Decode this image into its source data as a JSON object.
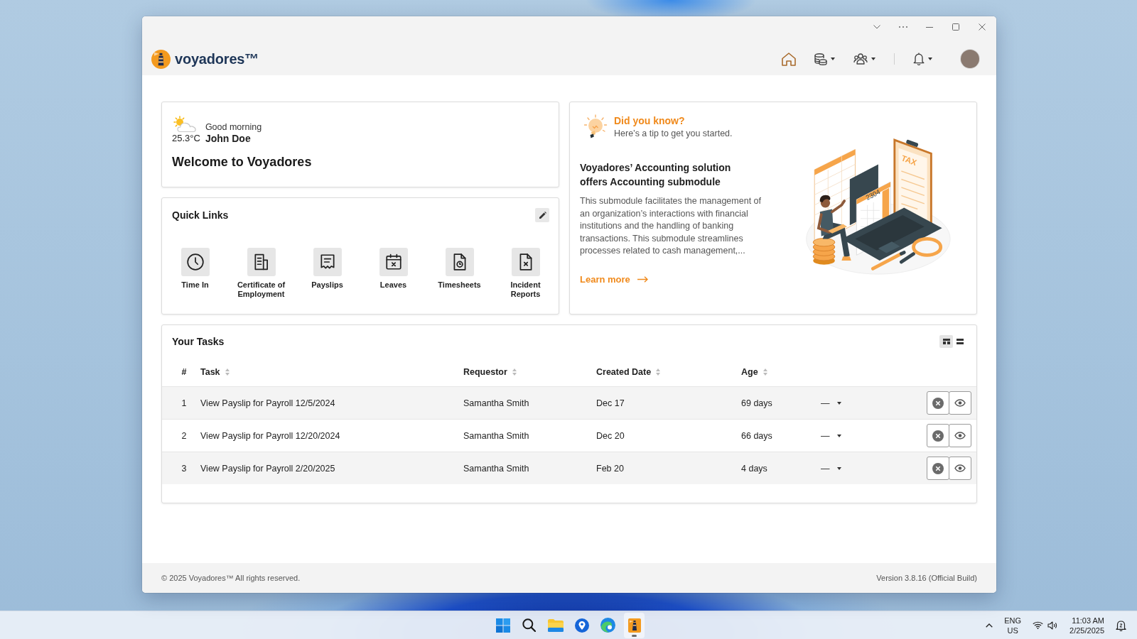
{
  "header": {
    "logo": "voyadores™"
  },
  "welcome": {
    "greeting": "Good morning",
    "temperature": "25.3°C",
    "user_name": "John Doe",
    "title": "Welcome to Voyadores"
  },
  "quick_links": {
    "title": "Quick Links",
    "items": [
      {
        "kind": "clock",
        "label": "Time In"
      },
      {
        "kind": "certificate",
        "label": "Certificate of Employment"
      },
      {
        "kind": "receipt",
        "label": "Payslips"
      },
      {
        "kind": "calendar-x",
        "label": "Leaves"
      },
      {
        "kind": "file-clock",
        "label": "Timesheets"
      },
      {
        "kind": "file-x",
        "label": "Incident Reports"
      }
    ]
  },
  "tip": {
    "title": "Did you know?",
    "subtitle": "Here’s a tip to get you started.",
    "heading": "Voyadores’ Accounting solution offers Accounting submodule",
    "body": "This submodule facilitates the management of an organization’s interactions with financial institutions and the handling of banking transactions. This submodule streamlines processes related to cash management,...",
    "link": "Learn more",
    "illustration": {
      "clipboard_label": "TAX",
      "calculator_display": "2304"
    }
  },
  "tasks": {
    "title": "Your Tasks",
    "view_toggle": [
      {
        "kind": "board",
        "selected": true
      },
      {
        "kind": "list",
        "selected": false
      }
    ],
    "columns": [
      {
        "label": "#",
        "sortable": false
      },
      {
        "label": "Task",
        "sortable": true
      },
      {
        "label": "Requestor",
        "sortable": true
      },
      {
        "label": "Created Date",
        "sortable": true
      },
      {
        "label": "Age",
        "sortable": true
      }
    ],
    "rows": [
      {
        "index": "1",
        "task": "View Payslip for Payroll 12/5/2024",
        "requestor": "Samantha Smith",
        "created_date": "Dec 17",
        "age": "69 days",
        "column_6": "—"
      },
      {
        "index": "2",
        "task": "View Payslip for Payroll 12/20/2024",
        "requestor": "Samantha Smith",
        "created_date": "Dec 20",
        "age": "66 days",
        "column_6": "—"
      },
      {
        "index": "3",
        "task": "View Payslip for Payroll 2/20/2025",
        "requestor": "Samantha Smith",
        "created_date": "Feb 20",
        "age": "4 days",
        "column_6": "—"
      }
    ]
  },
  "footer": {
    "copyright": "© 2025 Voyadores™ All rights reserved.",
    "version": "Version 3.8.16 (Official Build)"
  },
  "taskbar": {
    "apps": [
      {
        "kind": "start",
        "running": false
      },
      {
        "kind": "search",
        "running": false
      },
      {
        "kind": "files",
        "running": false
      },
      {
        "kind": "maps",
        "running": false
      },
      {
        "kind": "browser",
        "running": false
      },
      {
        "kind": "voyadores",
        "running": true
      }
    ],
    "language": "ENG",
    "region": "US",
    "time": "11:03 AM",
    "date": "2/25/2025"
  }
}
